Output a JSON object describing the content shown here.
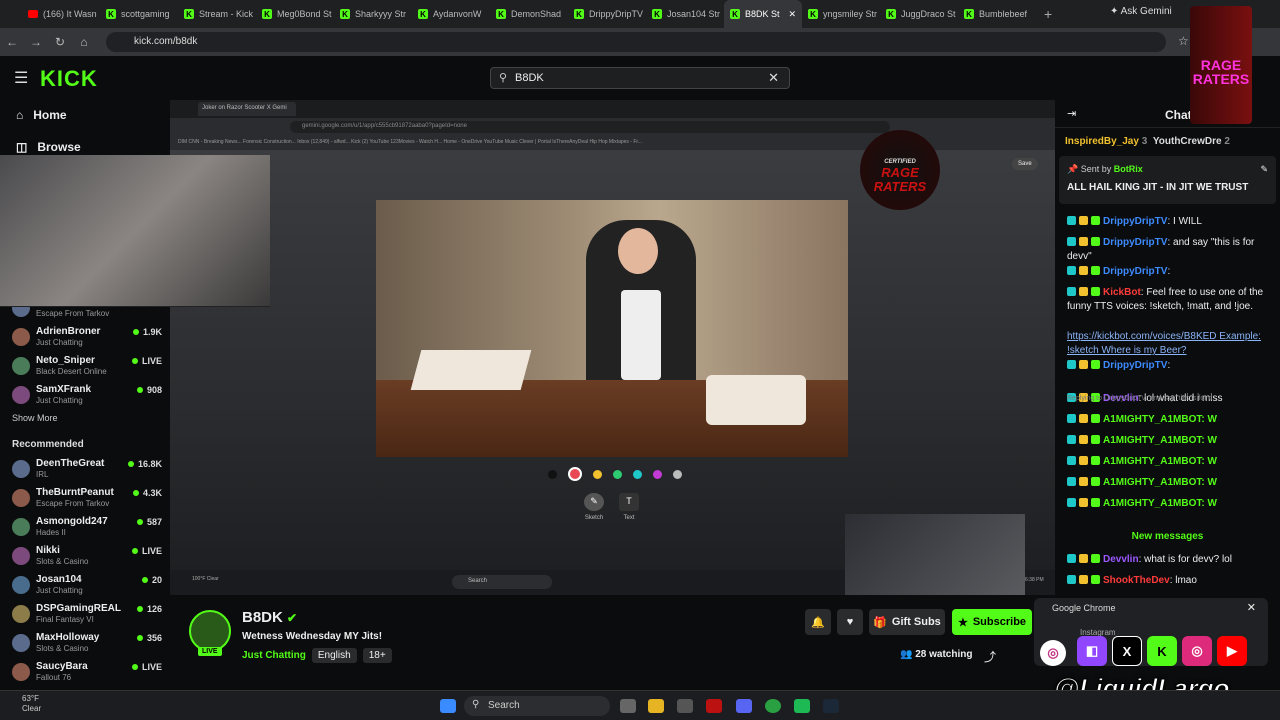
{
  "browser": {
    "tabs": [
      {
        "label": "(166) It Wasn",
        "icon": "youtube-icon"
      },
      {
        "label": "scottgaming",
        "icon": "kick-icon"
      },
      {
        "label": "Stream - Kick",
        "icon": "kick-icon"
      },
      {
        "label": "Meg0Bond St",
        "icon": "kick-icon"
      },
      {
        "label": "Sharkyyy Str",
        "icon": "kick-icon"
      },
      {
        "label": "AydanvonW",
        "icon": "kick-icon"
      },
      {
        "label": "DemonShad",
        "icon": "kick-icon"
      },
      {
        "label": "DrippyDripTV",
        "icon": "kick-icon"
      },
      {
        "label": "Josan104 Str",
        "icon": "kick-icon"
      },
      {
        "label": "B8DK St",
        "icon": "kick-icon",
        "active": true
      },
      {
        "label": "yngsmiley Str",
        "icon": "kick-icon"
      },
      {
        "label": "JuggDraco St",
        "icon": "kick-icon"
      },
      {
        "label": "Bumblebeef",
        "icon": "kick-icon"
      }
    ],
    "new_tab": "+",
    "ask_gemini": "Ask Gemini",
    "url": "kick.com/b8dk"
  },
  "header": {
    "logo": "KICK",
    "search_value": "B8DK"
  },
  "sidebar": {
    "nav": [
      {
        "label": "Home",
        "icon": "home-icon"
      },
      {
        "label": "Browse",
        "icon": "browse-icon"
      }
    ],
    "following": [
      {
        "name": "",
        "category": "Escape From Tarkov",
        "viewers": ""
      },
      {
        "name": "AdrienBroner",
        "category": "Just Chatting",
        "viewers": "1.9K"
      },
      {
        "name": "Neto_Sniper",
        "category": "Black Desert Online",
        "viewers": "LIVE"
      },
      {
        "name": "SamXFrank",
        "category": "Just Chatting",
        "viewers": "908"
      }
    ],
    "show_more": "Show More",
    "recommended_title": "Recommended",
    "recommended": [
      {
        "name": "DeenTheGreat",
        "category": "IRL",
        "viewers": "16.8K"
      },
      {
        "name": "TheBurntPeanut",
        "category": "Escape From Tarkov",
        "viewers": "4.3K"
      },
      {
        "name": "Asmongold247",
        "category": "Hades II",
        "viewers": "587"
      },
      {
        "name": "Nikki",
        "category": "Slots & Casino",
        "viewers": "LIVE"
      },
      {
        "name": "Josan104",
        "category": "Just Chatting",
        "viewers": "20"
      },
      {
        "name": "DSPGamingREAL",
        "category": "Final Fantasy VI",
        "viewers": "126"
      },
      {
        "name": "MaxHolloway",
        "category": "Slots & Casino",
        "viewers": "356"
      },
      {
        "name": "SaucyBara",
        "category": "Fallout 76",
        "viewers": "LIVE"
      }
    ]
  },
  "player": {
    "inner_tab": "Joker on Razor Scooter X Gemi",
    "inner_url": "gemini.google.com/u/1/app/c555cb91872aaba0?pageId=none",
    "inner_bookmarks": "DIM   CNN - Breaking News...   Forensic Construction...   Inbox (12,849) - alfwd...   Kick   (2) YouTube   123Movies - Watch H...   Home - OneDrive   YouTube Music   Clever | Portal   IsThereAnyDeal   Hip Hop Mixtapes - Fr...",
    "badge_top": "CERTIFIED",
    "badge_text": "RAGE RATERS",
    "save_label": "Save",
    "palette": [
      "#111111",
      "#e84855",
      "#f2c12e",
      "#2ecc71",
      "#1ec8c8",
      "#c23bd4",
      "#bbbbbb"
    ],
    "tools": [
      {
        "label": "Sketch",
        "icon": "sketch-icon"
      },
      {
        "label": "Text",
        "icon": "text-icon"
      }
    ],
    "weather_inner": "100°F Clear",
    "inner_search": "Search",
    "inner_clock": "6:38 PM"
  },
  "chat": {
    "title": "Chat",
    "top_users": [
      "InspiredBy_Jay",
      "YouthCrewDre"
    ],
    "top_counts": [
      "3",
      "2"
    ],
    "pinned_by": "BotRix",
    "pinned_label": "Sent by",
    "pinned_text": "ALL HAIL KING JIT - IN JIT WE TRUST",
    "messages": [
      {
        "user": "DrippyDripTV",
        "text": ": I WILL",
        "color": "#3d8bff"
      },
      {
        "user": "DrippyDripTV",
        "text": ": and say \"this is for devv\"",
        "color": "#3d8bff"
      },
      {
        "user": "DrippyDripTV",
        "text": ":",
        "color": "#3d8bff"
      },
      {
        "user": "KickBot",
        "text": ": Feel free to use one of the funny TTS voices: !sketch, !matt, and !joe.",
        "color": "#ff3b3b"
      },
      {
        "user": "",
        "text": "https://kickbot.com/voices/B8KED Example: !sketch Where is my Beer?",
        "color": "#eeeeee"
      },
      {
        "user": "DrippyDripTV",
        "text": ":",
        "color": "#3d8bff"
      },
      {
        "user": "Devvlin",
        "text": ": lol what did i miss",
        "color": "#9b59ff"
      },
      {
        "user": "A1MIGHTY_A1MBOT",
        "text": ": W",
        "color": "#53fc18"
      },
      {
        "user": "A1MIGHTY_A1MBOT",
        "text": ": W",
        "color": "#53fc18"
      },
      {
        "user": "A1MIGHTY_A1MBOT",
        "text": ": W",
        "color": "#53fc18"
      },
      {
        "user": "A1MIGHTY_A1MBOT",
        "text": ": W",
        "color": "#53fc18"
      },
      {
        "user": "A1MIGHTY_A1MBOT",
        "text": ": W",
        "color": "#53fc18"
      }
    ],
    "reply_hint": "Replying to DrippyDripTV: and say \"this is for d...",
    "new_messages": "New messages",
    "after": [
      {
        "user": "Devvlin",
        "text": ": what is for devv? lol",
        "color": "#9b59ff"
      },
      {
        "user": "ShookTheDev",
        "text": ": lmao",
        "color": "#ff3b3b"
      }
    ]
  },
  "stream": {
    "name": "B8DK",
    "live": "LIVE",
    "title": "Wetness Wednesday MY Jits!",
    "category": "Just Chatting",
    "tags": [
      "English",
      "18+"
    ],
    "gift": "Gift Subs",
    "subscribe": "Subscribe",
    "watching": "28 watching"
  },
  "overlay": {
    "popup_title": "Google Chrome",
    "popup_sub": "Instagram",
    "handle": "@LiquidLargo",
    "socials": [
      "twitch",
      "x",
      "kick",
      "instagram",
      "youtube"
    ]
  },
  "taskbar": {
    "temp": "63°F",
    "weather": "Clear",
    "search": "Search"
  },
  "colors": {
    "accent": "#53fc18",
    "bg": "#0b0c0d"
  }
}
